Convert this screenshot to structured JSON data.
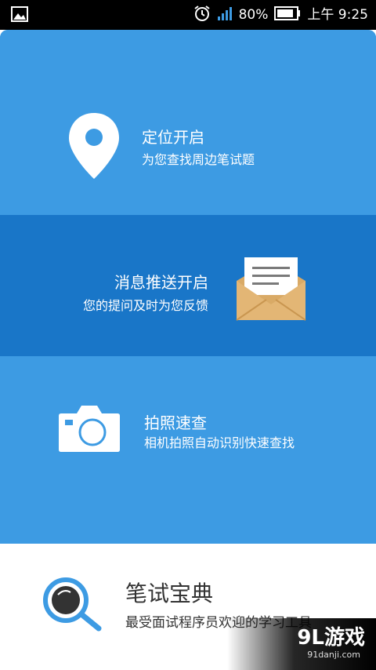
{
  "status_bar": {
    "battery": "80%",
    "time": "上午 9:25",
    "icons": [
      "gallery-icon",
      "alarm-icon",
      "signal-icon",
      "battery-icon"
    ]
  },
  "features": [
    {
      "icon": "location-pin-icon",
      "title": "定位开启",
      "subtitle": "为您查找周边笔试题"
    },
    {
      "icon": "envelope-icon",
      "title": "消息推送开启",
      "subtitle": "您的提问及时为您反馈"
    },
    {
      "icon": "camera-icon",
      "title": "拍照速查",
      "subtitle": "相机拍照自动识别快速查找"
    }
  ],
  "app_info": {
    "icon": "app-logo-magnifier-icon",
    "name": "笔试宝典",
    "tagline": "最受面试程序员欢迎的学习工具"
  },
  "watermark": {
    "brand": "9L游戏",
    "site": "91danji.com"
  },
  "colors": {
    "panel_light": "#3d9be3",
    "panel_dark": "#1976c8",
    "envelope": "#d9aa66"
  }
}
